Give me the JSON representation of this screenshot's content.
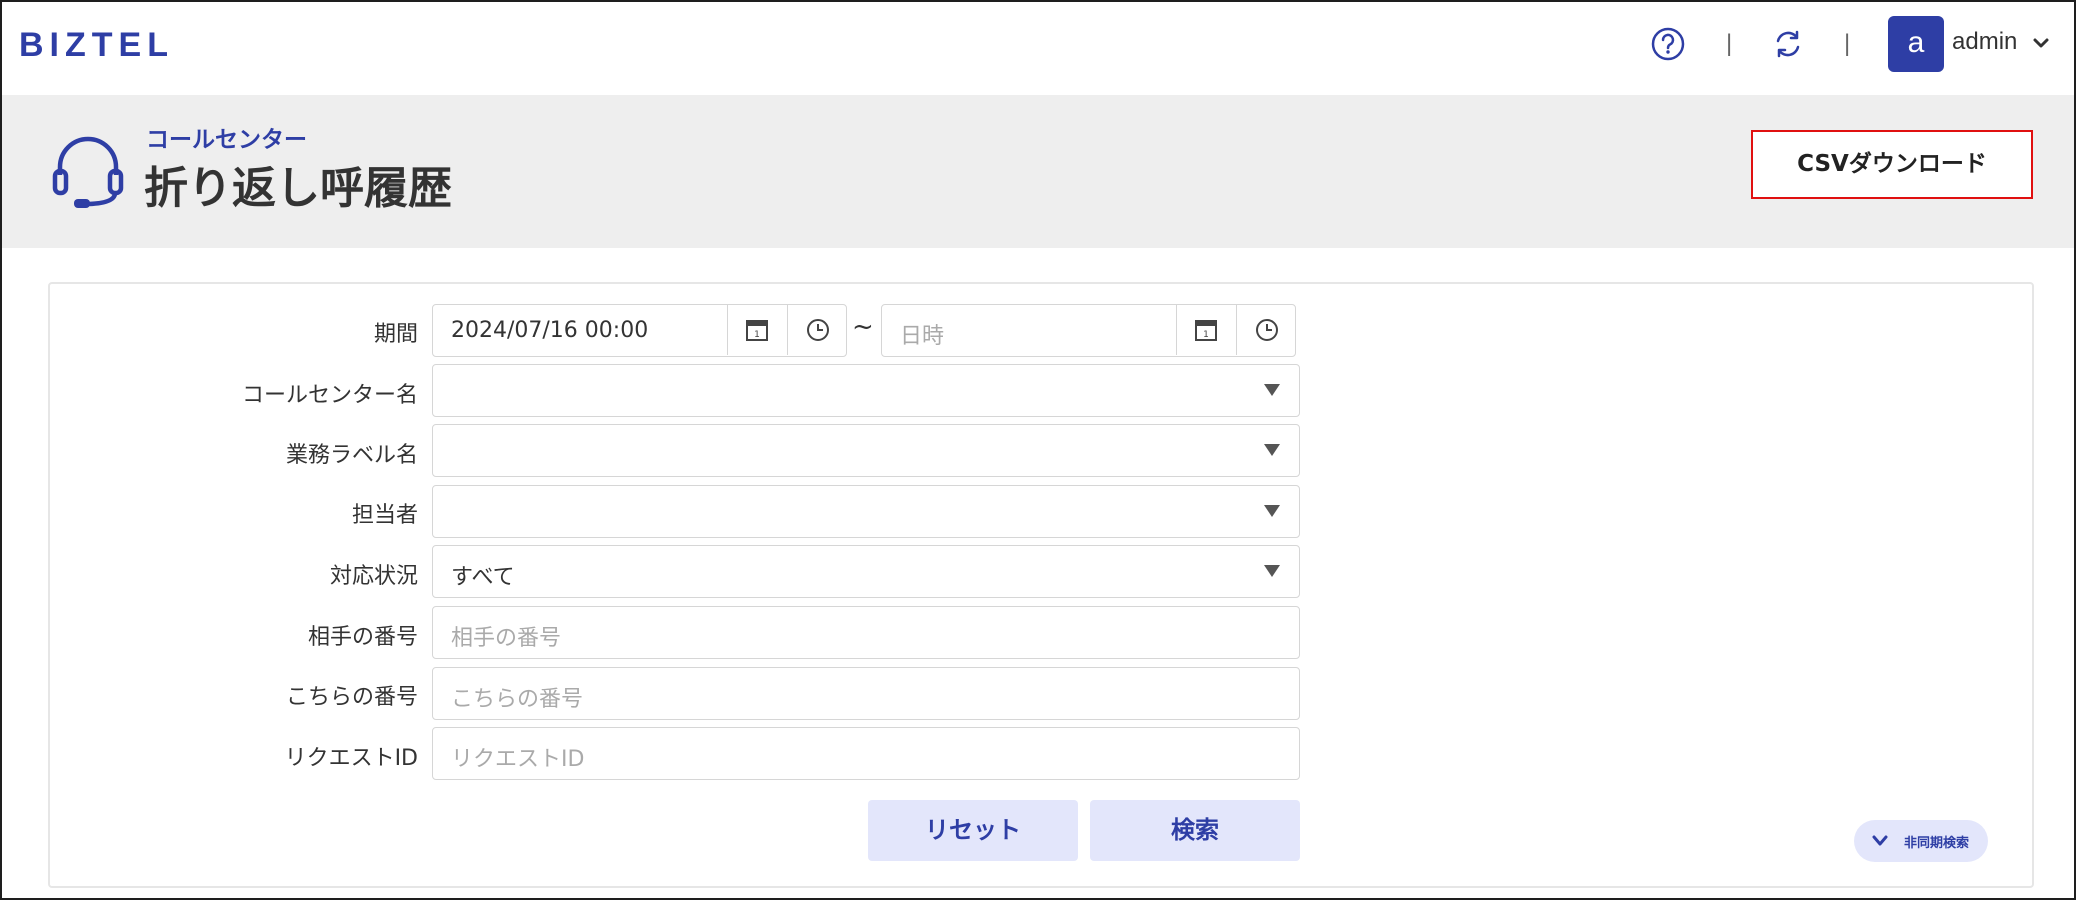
{
  "topbar": {
    "logo": "BIZTEL",
    "separators": [
      "|",
      "|"
    ],
    "user_initial": "a",
    "user_name": "admin"
  },
  "header": {
    "subtitle": "コールセンター",
    "title": "折り返し呼履歴",
    "csv_button": "CSVダウンロード"
  },
  "form": {
    "period": {
      "label": "期間",
      "start_value": "2024/07/16 00:00",
      "separator": "~",
      "end_placeholder": "日時"
    },
    "call_center": {
      "label": "コールセンター名",
      "value": ""
    },
    "business_label": {
      "label": "業務ラベル名",
      "value": ""
    },
    "assignee": {
      "label": "担当者",
      "value": ""
    },
    "status": {
      "label": "対応状況",
      "value": "すべて"
    },
    "their_number": {
      "label": "相手の番号",
      "placeholder": "相手の番号"
    },
    "our_number": {
      "label": "こちらの番号",
      "placeholder": "こちらの番号"
    },
    "request_id": {
      "label": "リクエストID",
      "placeholder": "リクエストID"
    },
    "reset_button": "リセット",
    "search_button": "検索",
    "async_search_button": "非同期検索"
  },
  "colors": {
    "brand": "#2e3ea5",
    "button_bg": "#e3e6fb",
    "header_band": "#eeeeee",
    "highlight_border": "#e01010"
  }
}
